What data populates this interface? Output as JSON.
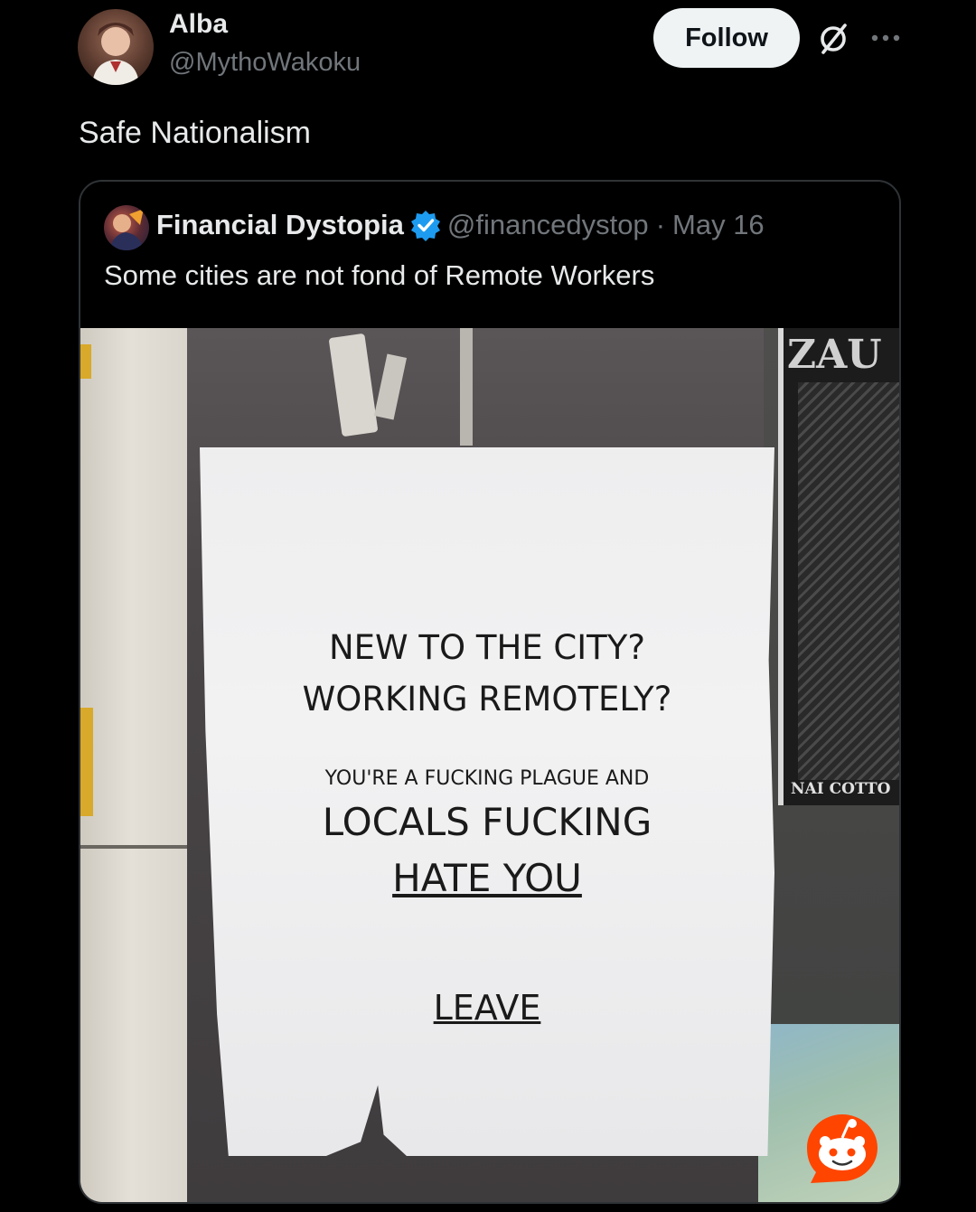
{
  "author": {
    "display_name": "Alba",
    "handle": "@MythoWakoku"
  },
  "header": {
    "follow_label": "Follow"
  },
  "post": {
    "text": "Safe Nationalism"
  },
  "quoted_post": {
    "display_name": "Financial Dystopia",
    "handle": "@financedystop",
    "separator": "·",
    "date": "May 16",
    "text": "Some cities are not fond of Remote Workers",
    "verified_color": "#1d9bf0"
  },
  "photo": {
    "notice_lines": [
      "NEW TO THE CITY?",
      "WORKING REMOTELY?",
      "YOU'RE A FUCKING PLAGUE AND",
      "LOCALS FUCKING",
      "HATE YOU",
      "LEAVE"
    ],
    "right_poster_top": "ZAU",
    "right_poster_label": "NAI COTTO"
  },
  "icons": {
    "avatar": "user-avatar",
    "grok": "grok-icon",
    "more": "more-options-icon",
    "verified": "verified-badge-icon",
    "watermark": "reddit-icon"
  },
  "colors": {
    "background": "#000000",
    "text_primary": "#e7e9ea",
    "text_secondary": "#71767b",
    "follow_button_bg": "#eff3f4",
    "border": "#2f3336",
    "reddit_orange": "#ff4500"
  }
}
